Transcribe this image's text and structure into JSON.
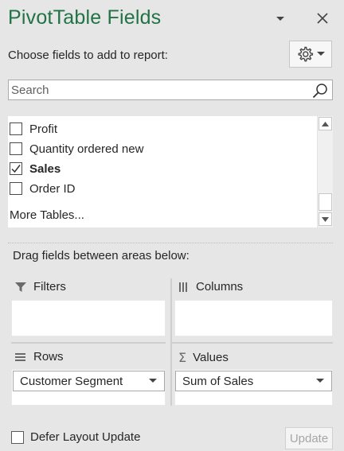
{
  "header": {
    "title": "PivotTable Fields",
    "dropdown_icon": "chevron-down-icon",
    "close_icon": "close-icon"
  },
  "choose_label": "Choose fields to add to report:",
  "tools_button": {
    "icon": "gear-icon",
    "caret_icon": "chevron-down-icon"
  },
  "search": {
    "placeholder": "Search",
    "value": "",
    "icon": "search-icon"
  },
  "fields": [
    {
      "label": "Profit",
      "checked": false
    },
    {
      "label": "Quantity ordered new",
      "checked": false
    },
    {
      "label": "Sales",
      "checked": true
    },
    {
      "label": "Order ID",
      "checked": false
    }
  ],
  "more_tables": "More Tables...",
  "drag_text": "Drag fields between areas below:",
  "areas": {
    "filters": {
      "label": "Filters",
      "icon": "filter-icon",
      "items": []
    },
    "columns": {
      "label": "Columns",
      "icon": "columns-icon",
      "items": []
    },
    "rows": {
      "label": "Rows",
      "icon": "rows-icon",
      "items": [
        "Customer Segment"
      ]
    },
    "values": {
      "label": "Values",
      "icon": "sigma-icon",
      "items": [
        "Sum of Sales"
      ]
    }
  },
  "footer": {
    "defer_label": "Defer Layout Update",
    "defer_checked": false,
    "update_label": "Update",
    "update_enabled": false
  },
  "colors": {
    "title": "#217346",
    "panel_background": "#e6e6e6",
    "box_background": "#ffffff"
  }
}
